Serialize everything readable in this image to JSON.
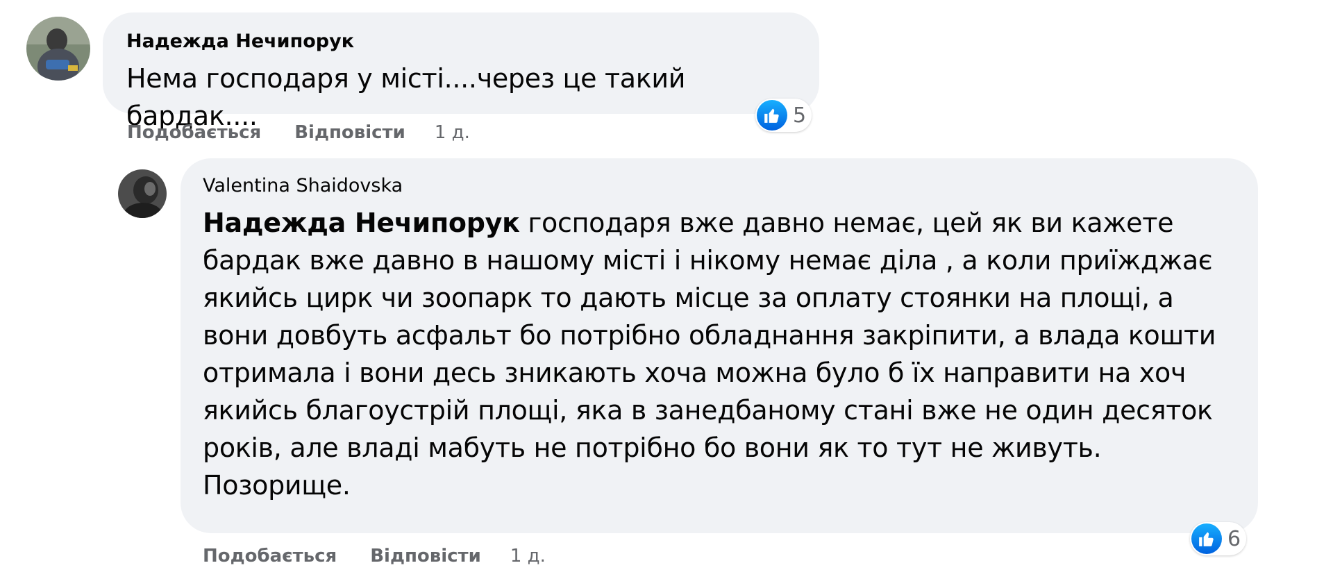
{
  "colors": {
    "bubble": "#f0f2f5",
    "meta_text": "#65676b",
    "like_blue": "#1877f2"
  },
  "comment1": {
    "author": "Надежда Нечипорук",
    "text": "Нема господаря у місті....через це такий бардак....",
    "reaction_icon": "like-icon",
    "reaction_count": "5",
    "actions": {
      "like": "Подобається",
      "reply": "Відповісти",
      "time": "1 д."
    }
  },
  "reply1": {
    "author": "Valentina Shaidovska",
    "mention": "Надежда Нечипорук",
    "text": "господаря вже давно немає, цей як ви кажете бардак вже давно в нашому місті і нікому немає діла , а коли приїжджає якийсь цирк чи зоопарк то дають місце за оплату стоянки на площі, а вони довбуть асфальт бо потрібно обладнання закріпити, а влада кошти отримала і вони десь зникають хоча можна було б їх направити на хоч якийсь благоустрій площі, яка в занедбаному стані вже не один десяток років, але владі мабуть не потрібно бо вони як то тут не живуть. Позорище.",
    "reaction_icon": "like-icon",
    "reaction_count": "6",
    "actions": {
      "like": "Подобається",
      "reply": "Відповісти",
      "time": "1 д."
    }
  }
}
